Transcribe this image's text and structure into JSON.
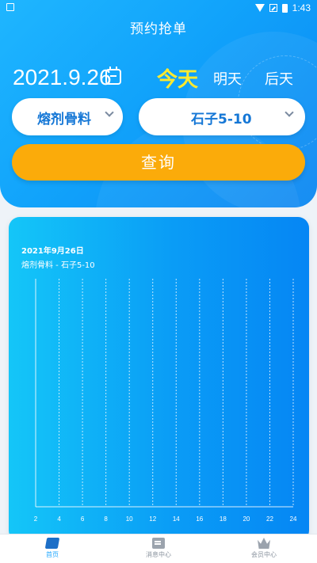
{
  "status_bar": {
    "time": "1:43"
  },
  "header": {
    "title": "预约抢单"
  },
  "date_picker": {
    "date": "2021.9.26"
  },
  "day_tabs": [
    {
      "label": "今天",
      "selected": true
    },
    {
      "label": "明天",
      "selected": false
    },
    {
      "label": "后天",
      "selected": false
    }
  ],
  "selects": {
    "material": {
      "value": "熔剂骨料"
    },
    "spec": {
      "value": "石子5-10"
    }
  },
  "query_button": {
    "label": "查询"
  },
  "chart_card": {
    "date_label": "2021年9月26日",
    "subtitle": "熔剂骨料 - 石子5-10"
  },
  "chart_data": {
    "type": "bar",
    "categories": [
      "2",
      "4",
      "6",
      "8",
      "10",
      "12",
      "14",
      "16",
      "18",
      "20",
      "22",
      "24"
    ],
    "values": [],
    "title": "",
    "xlabel": "",
    "ylabel": "",
    "grid": true
  },
  "tabbar": {
    "items": [
      {
        "label": "首页",
        "active": true
      },
      {
        "label": "消息中心",
        "active": false
      },
      {
        "label": "会员中心",
        "active": false
      }
    ]
  },
  "colors": {
    "header_gradient_start": "#1fb6ff",
    "header_gradient_end": "#0a86f2",
    "today_highlight": "#ffea2e",
    "query_button": "#fbab0a",
    "select_text": "#1577d6",
    "tab_active": "#22a8ff"
  }
}
